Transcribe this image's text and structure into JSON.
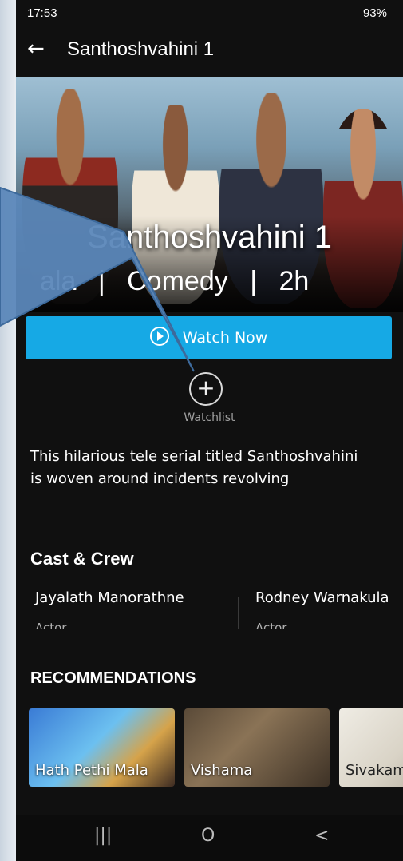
{
  "status": {
    "time": "17:53",
    "right": "93%"
  },
  "header": {
    "back_icon": "arrow-left-icon",
    "title": "Santhoshvahini 1"
  },
  "hero": {
    "title": "Santhoshvahini 1",
    "meta": [
      "ala",
      "|",
      "Comedy",
      "|",
      "2h"
    ]
  },
  "actions": {
    "watch_label": "Watch Now",
    "watchlist_symbol": "+",
    "watchlist_label": "Watchlist"
  },
  "description": "This hilarious tele serial titled Santhoshvahini is woven around incidents revolving",
  "cast": {
    "heading": "Cast & Crew",
    "members": [
      {
        "name": "Jayalath Manorathne",
        "role": "Actor"
      },
      {
        "name": "Rodney Warnakula",
        "role": "Actor"
      }
    ]
  },
  "recommendations": {
    "heading": "RECOMMENDATIONS",
    "items": [
      "Hath Pethi Mala",
      "Vishama",
      "Sivakami"
    ]
  },
  "navbar": {
    "recent": "|||",
    "home": "O",
    "back": "<"
  },
  "colors": {
    "accent": "#16a9e5",
    "callout": "#5b87b9"
  }
}
